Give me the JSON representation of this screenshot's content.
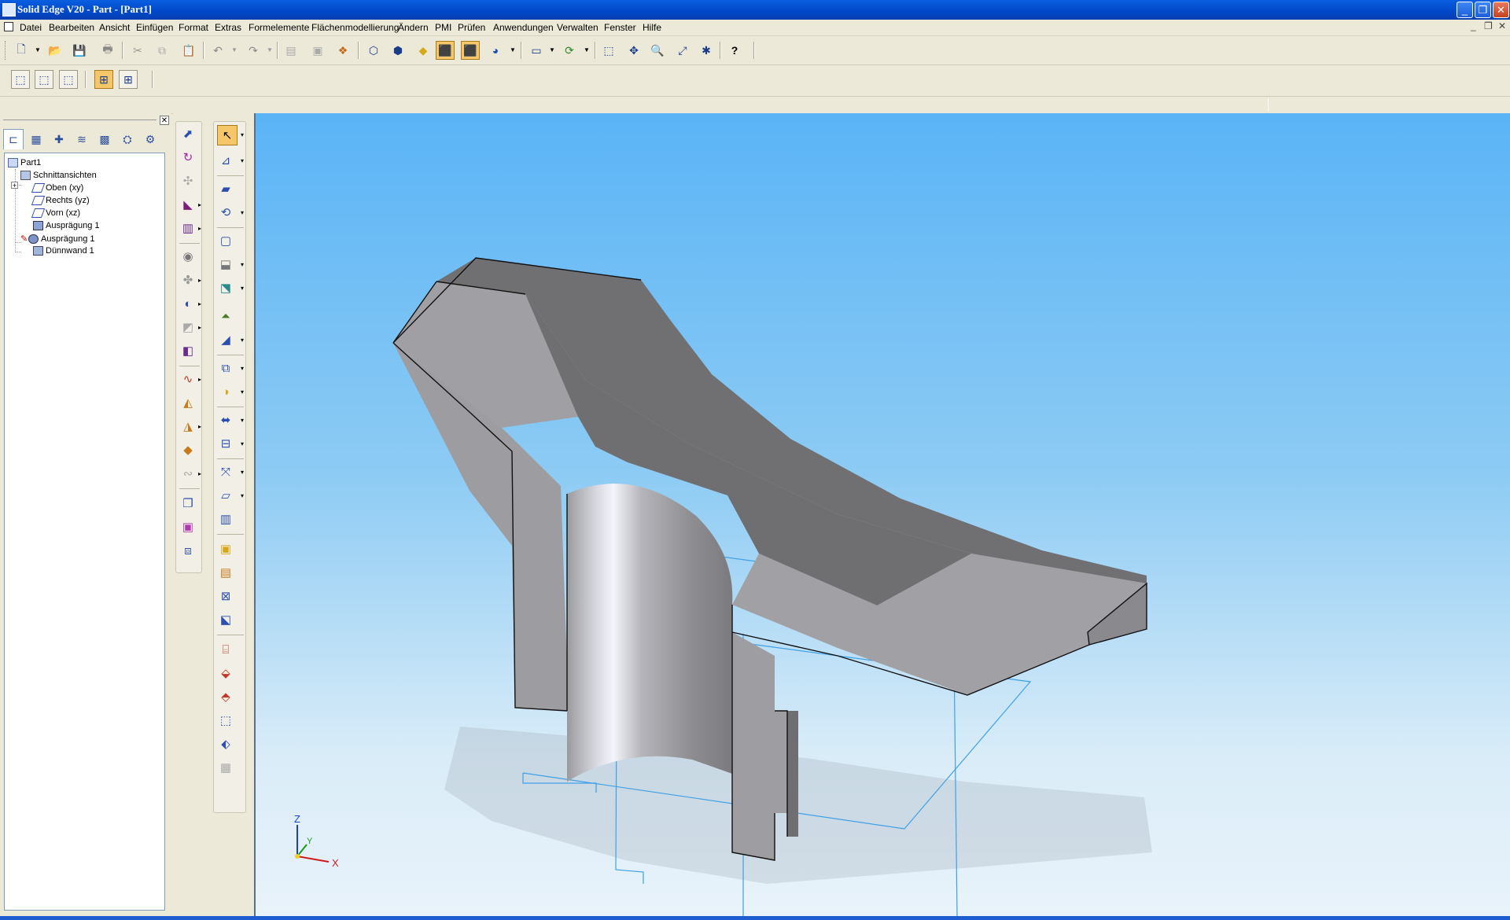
{
  "window": {
    "title": "Solid Edge V20 - Part - [Part1]",
    "min_icon": "minimize-icon",
    "max_icon": "restore-icon",
    "close_icon": "close-icon"
  },
  "menu": {
    "items": [
      "Datei",
      "Bearbeiten",
      "Ansicht",
      "Einfügen",
      "Format",
      "Extras",
      "Formelemente",
      "Flächenmodellierung",
      "Ändern",
      "PMI",
      "Prüfen",
      "Anwendungen",
      "Verwalten",
      "Fenster",
      "Hilfe"
    ],
    "mdi_controls": [
      "_",
      "❐",
      "✕"
    ]
  },
  "toolbar": {
    "main_icons": [
      "new-file-icon",
      "open-folder-icon",
      "save-icon",
      "print-icon",
      "cut-icon",
      "copy-icon",
      "paste-icon",
      "undo-icon",
      "redo-icon",
      "paste-special-icon",
      "insert-object-icon",
      "assembly-icon",
      "wireframe-view-icon",
      "visible-edges-view-icon",
      "shaded-view-icon",
      "shaded-edges-view-icon",
      "shaded-visible-edges-icon",
      "sphere-render-icon",
      "named-views-icon",
      "rotate-view-icon",
      "zoom-area-icon",
      "pan-icon",
      "zoom-icon",
      "fit-icon",
      "spin-icon",
      "whats-this-help-icon"
    ],
    "secondary_icons": [
      "select-tools-1-icon",
      "select-tools-2-icon",
      "select-tools-3-icon",
      "selection-filter-1-icon",
      "selection-filter-2-icon"
    ],
    "help_glyph": "?"
  },
  "pathfinder": {
    "tabs": [
      "edgebar-pathfinder-icon",
      "feature-library-icon",
      "family-parts-icon",
      "layers-icon",
      "feature-playback-icon",
      "sensors-icon",
      "variable-icon"
    ],
    "close_label": "✕",
    "tree": [
      {
        "label": "Part1",
        "icon": "part-icon"
      },
      {
        "label": "Schnittansichten",
        "icon": "section-views-icon"
      },
      {
        "label": "Oben (xy)",
        "icon": "reference-plane-icon"
      },
      {
        "label": "Rechts (yz)",
        "icon": "reference-plane-icon"
      },
      {
        "label": "Vorn (xz)",
        "icon": "reference-plane-icon"
      },
      {
        "label": "Ausprägung 1",
        "icon": "protrusion-icon"
      },
      {
        "label": "Ausprägung 1",
        "icon": "revolved-protrusion-icon"
      },
      {
        "label": "Dünnwand 1",
        "icon": "thinwall-icon"
      }
    ],
    "expander_plus": "+"
  },
  "features_bar": {
    "icons": [
      "protrusion-tool-icon",
      "revolve-tool-icon",
      "cutout-tool-icon",
      "swept-tool-icon",
      "lofted-tool-icon",
      "hole-tool-icon",
      "rib-tool-icon",
      "round-tool-icon",
      "chamfer-tool-icon",
      "draft-tool-icon",
      "curve-tool-icon",
      "normal-protrusion-icon",
      "thicken-tool-icon",
      "emboss-tool-icon",
      "web-network-icon",
      "part-copy-icon",
      "face-rotate-icon",
      "mirror-copy-icon"
    ]
  },
  "tools_bar": {
    "icons": [
      "select-arrow-icon",
      "sketch-icon",
      "extrude-icon",
      "revolve-icon",
      "helix-icon",
      "thin-wall-icon",
      "thin-region-icon",
      "draft-icon",
      "pattern-icon",
      "mirror-icon",
      "boolean-icon",
      "offset-surface-icon",
      "coordinate-system-icon",
      "plane-icon",
      "divide-part-icon",
      "insert-part-icon",
      "save-part-icon",
      "move-face-icon",
      "scale-icon",
      "box-icon",
      "cylinder-icon",
      "sphere-primitive-icon",
      "body-icon",
      "library-icon",
      "disk-icon"
    ]
  },
  "triad": {
    "x": "X",
    "y": "Y",
    "z": "Z"
  },
  "colors": {
    "title_blue": "#0a5fe0",
    "viewport_top": "#5ab4f6",
    "viewport_bottom": "#e9f3fa",
    "model_face_light": "#a3a3a6",
    "model_face_dark": "#79797c",
    "plane_line": "#4aa3e0",
    "pressed_button": "#f6c66a"
  }
}
